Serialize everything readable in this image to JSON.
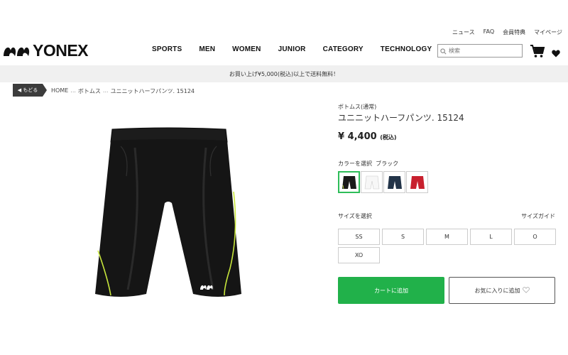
{
  "utility_links": [
    "ニュース",
    "FAQ",
    "会員特典",
    "マイページ"
  ],
  "brand": {
    "logo_text": "YONEX"
  },
  "nav": [
    "SPORTS",
    "MEN",
    "WOMEN",
    "JUNIOR",
    "CATEGORY",
    "TECHNOLOGY"
  ],
  "search": {
    "placeholder": "検索"
  },
  "banner": "お買い上げ¥5,000(税込)以上で送料無料！",
  "breadcrumb": {
    "back_label": "◀ もどる",
    "items": [
      "HOME",
      "ボトムス",
      "ユニニットハーフパンツ. 15124"
    ],
    "separator": "..."
  },
  "product": {
    "category": "ボトムス(通常)",
    "title": "ユニニットハーフパンツ. 15124",
    "price": "¥ 4,400",
    "price_tax": "(税込)",
    "color_label": "カラーを選択",
    "selected_color": "ブラック",
    "colors": [
      {
        "name": "black",
        "hex": "#1a1a1a"
      },
      {
        "name": "white",
        "hex": "#f7f7f7"
      },
      {
        "name": "navy",
        "hex": "#233449"
      },
      {
        "name": "red",
        "hex": "#c8202e"
      }
    ],
    "size_label": "サイズを選択",
    "size_guide": "サイズガイド",
    "sizes": [
      "SS",
      "S",
      "M",
      "L",
      "O",
      "XO"
    ],
    "add_to_cart": "カートに追加",
    "add_to_favorites": "お気に入りに追加"
  },
  "colors": {
    "accent": "#21b14a",
    "banner_bg": "#f0f0f0",
    "back_btn": "#3c3c3c"
  }
}
